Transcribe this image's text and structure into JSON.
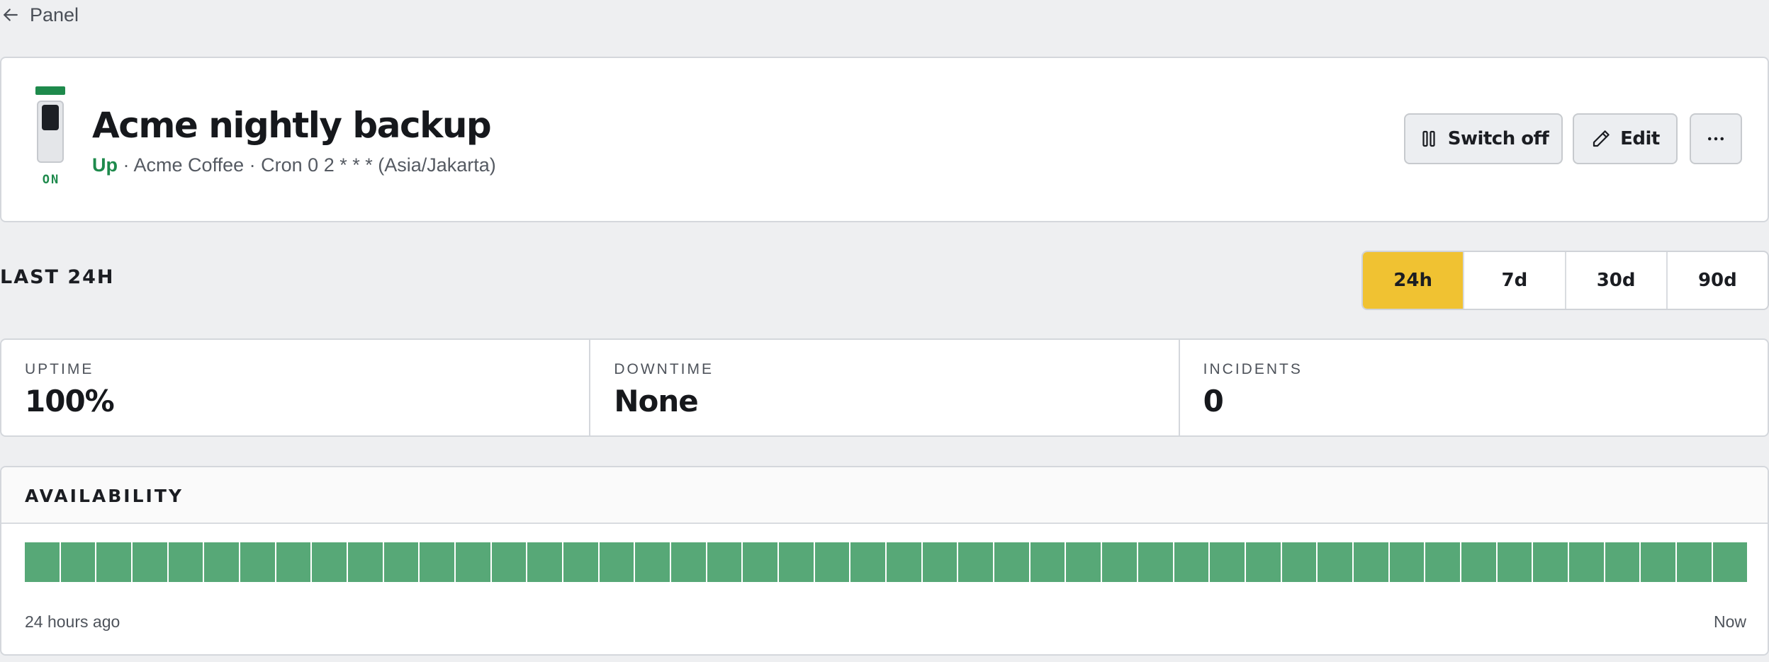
{
  "nav": {
    "back_label": "Panel"
  },
  "monitor": {
    "toggle_state": "ON",
    "name": "Acme nightly backup",
    "status": "Up",
    "separator": "·",
    "customer": "Acme Coffee",
    "schedule": "Cron 0 2 * * * (Asia/Jakarta)"
  },
  "actions": {
    "switch_off": "Switch off",
    "edit": "Edit"
  },
  "period": {
    "label": "LAST 24H",
    "options": [
      "24h",
      "7d",
      "30d",
      "90d"
    ],
    "selected": "24h"
  },
  "stats": [
    {
      "label": "UPTIME",
      "value": "100%"
    },
    {
      "label": "DOWNTIME",
      "value": "None"
    },
    {
      "label": "INCIDENTS",
      "value": "0"
    }
  ],
  "availability": {
    "title": "AVAILABILITY",
    "start_label": "24 hours ago",
    "end_label": "Now",
    "bar_color": "#57a877",
    "slots": [
      "up",
      "up",
      "up",
      "up",
      "up",
      "up",
      "up",
      "up",
      "up",
      "up",
      "up",
      "up",
      "up",
      "up",
      "up",
      "up",
      "up",
      "up",
      "up",
      "up",
      "up",
      "up",
      "up",
      "up",
      "up",
      "up",
      "up",
      "up",
      "up",
      "up",
      "up",
      "up",
      "up",
      "up",
      "up",
      "up",
      "up",
      "up",
      "up",
      "up",
      "up",
      "up",
      "up",
      "up",
      "up",
      "up",
      "up",
      "up"
    ]
  },
  "colors": {
    "accent": "#f0c232",
    "success": "#1e8a4c"
  },
  "icons": {
    "back": "arrow-left-icon",
    "switch": "pause-icon",
    "edit": "pencil-icon",
    "more": "more-horizontal-icon"
  }
}
